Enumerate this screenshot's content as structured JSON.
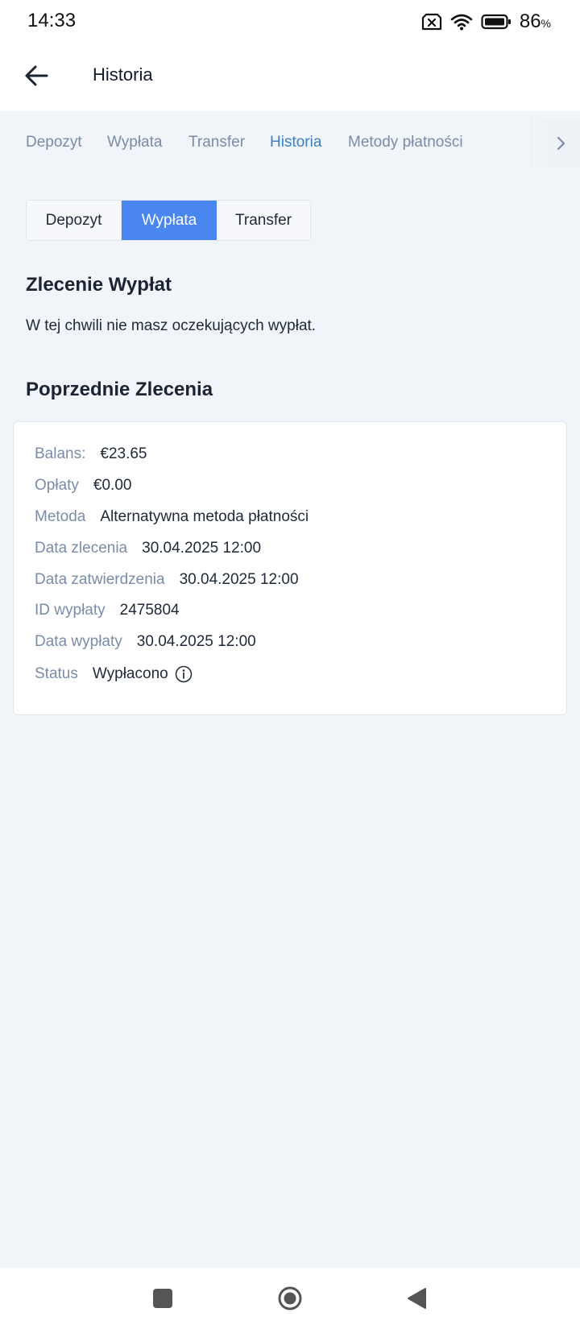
{
  "status_bar": {
    "time": "14:33",
    "battery_percent": "86",
    "battery_unit": "%"
  },
  "app_bar": {
    "title": "Historia"
  },
  "tabs": [
    {
      "label": "Depozyt",
      "active": false
    },
    {
      "label": "Wypłata",
      "active": false
    },
    {
      "label": "Transfer",
      "active": false
    },
    {
      "label": "Historia",
      "active": true
    },
    {
      "label": "Metody płatności",
      "active": false
    }
  ],
  "segmented": [
    {
      "label": "Depozyt",
      "active": false
    },
    {
      "label": "Wypłata",
      "active": true
    },
    {
      "label": "Transfer",
      "active": false
    }
  ],
  "pending": {
    "heading": "Zlecenie Wypłat",
    "message": "W tej chwili nie masz oczekujących wypłat."
  },
  "previous": {
    "heading": "Poprzednie Zlecenia",
    "rows": [
      {
        "label": "Balans:",
        "value": "€23.65"
      },
      {
        "label": "Opłaty",
        "value": "€0.00"
      },
      {
        "label": "Metoda",
        "value": "Alternatywna metoda płatności"
      },
      {
        "label": "Data zlecenia",
        "value": "30.04.2025 12:00"
      },
      {
        "label": "Data zatwierdzenia",
        "value": "30.04.2025 12:00"
      },
      {
        "label": "ID wypłaty",
        "value": "2475804"
      },
      {
        "label": "Data wypłaty",
        "value": "30.04.2025 12:00"
      },
      {
        "label": "Status",
        "value": "Wypłacono"
      }
    ]
  },
  "colors": {
    "accent": "#4a86f0",
    "tab_active": "#3d7ec4",
    "muted": "#7b8ca8",
    "background": "#f1f5f9"
  },
  "icons": {
    "back": "arrow-left-icon",
    "tabs_more": "chevron-right-icon",
    "status_info": "info-icon",
    "nav_recent": "square-icon",
    "nav_home": "circle-icon",
    "nav_back": "triangle-left-icon"
  }
}
